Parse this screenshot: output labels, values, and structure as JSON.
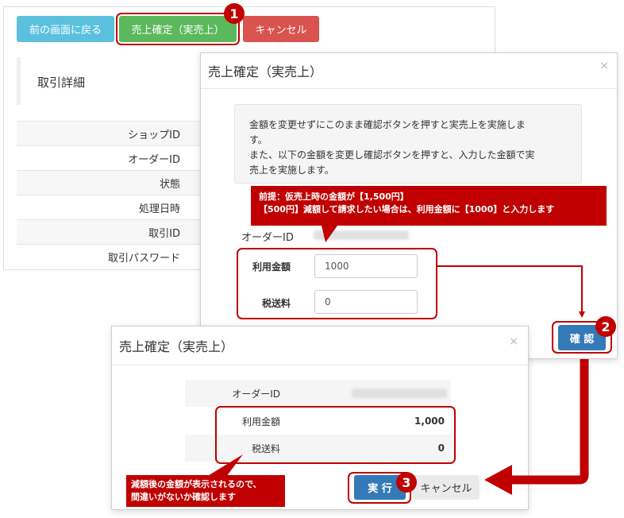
{
  "toolbar": {
    "back_label": "前の画面に戻る",
    "confirm_sale_label": "売上確定（実売上）",
    "cancel_label": "キャンセル"
  },
  "detail": {
    "title": "取引詳細",
    "rows": [
      "ショップID",
      "オーダーID",
      "状態",
      "処理日時",
      "取引ID",
      "取引パスワード"
    ]
  },
  "modal1": {
    "title": "売上確定（実売上）",
    "close": "×",
    "info_lines": [
      "金額を変更せずにこのまま確認ボタンを押すと実売上を実施しま",
      "す。",
      "また、以下の金額を変更し確認ボタンを押すと、入力した金額で実",
      "売上を実施します。"
    ],
    "order_id_label": "オーダーID",
    "amount_label": "利用金額",
    "amount_value": "1000",
    "tax_label": "税送料",
    "tax_value": "0",
    "confirm_label": "確 認"
  },
  "modal2": {
    "title": "売上確定（実売上）",
    "close": "×",
    "order_id_label": "オーダーID",
    "amount_label": "利用金額",
    "amount_value": "1,000",
    "tax_label": "税送料",
    "tax_value": "0",
    "execute_label": "実 行",
    "cancel_label": "キャンセル"
  },
  "callouts": {
    "top_lines": [
      "前提：仮売上時の金額が【1,500円】",
      "【500円】減額して請求したい場合は、利用金額に【1000】と入力します"
    ],
    "bottom_lines": [
      "減額後の金額が表示されるので、",
      "間違いがないか確認します"
    ]
  },
  "badges": [
    "1",
    "2",
    "3"
  ],
  "colors": {
    "highlight": "#c00000",
    "info": "#5bc0de",
    "success": "#5cb85c",
    "danger": "#d9534f",
    "primary": "#337ab7"
  }
}
